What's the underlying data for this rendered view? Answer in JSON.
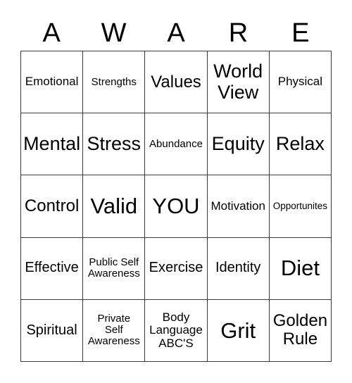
{
  "card": {
    "title_letters": [
      "A",
      "W",
      "A",
      "R",
      "E"
    ],
    "columns": 5,
    "rows": 5,
    "colors": {
      "background": "#ffffff",
      "cell_background": "#ffffff",
      "border": "#3c3c3c",
      "text": "#000000"
    },
    "cells": [
      {
        "label": "Emotional",
        "size": "sm"
      },
      {
        "label": "Strengths",
        "size": "xs"
      },
      {
        "label": "Values",
        "size": "lg"
      },
      {
        "label": "World View",
        "size": "xl"
      },
      {
        "label": "Physical",
        "size": "sm"
      },
      {
        "label": "Mental",
        "size": "xl"
      },
      {
        "label": "Stress",
        "size": "xl"
      },
      {
        "label": "Abundance",
        "size": "xs"
      },
      {
        "label": "Equity",
        "size": "xl"
      },
      {
        "label": "Relax",
        "size": "xl"
      },
      {
        "label": "Control",
        "size": "lg"
      },
      {
        "label": "Valid",
        "size": "xxl"
      },
      {
        "label": "YOU",
        "size": "xxl"
      },
      {
        "label": "Motivation",
        "size": "sm"
      },
      {
        "label": "Opportunites",
        "size": "xxs"
      },
      {
        "label": "Effective",
        "size": "md"
      },
      {
        "label": "Public Self\nAwareness",
        "size": "xs"
      },
      {
        "label": "Exercise",
        "size": "md"
      },
      {
        "label": "Identity",
        "size": "md"
      },
      {
        "label": "Diet",
        "size": "xxl"
      },
      {
        "label": "Spiritual",
        "size": "md"
      },
      {
        "label": "Private\nSelf\nAwareness",
        "size": "xs"
      },
      {
        "label": "Body\nLanguage\nABC'S",
        "size": "sm"
      },
      {
        "label": "Grit",
        "size": "xxl"
      },
      {
        "label": "Golden\nRule",
        "size": "lg"
      }
    ]
  }
}
